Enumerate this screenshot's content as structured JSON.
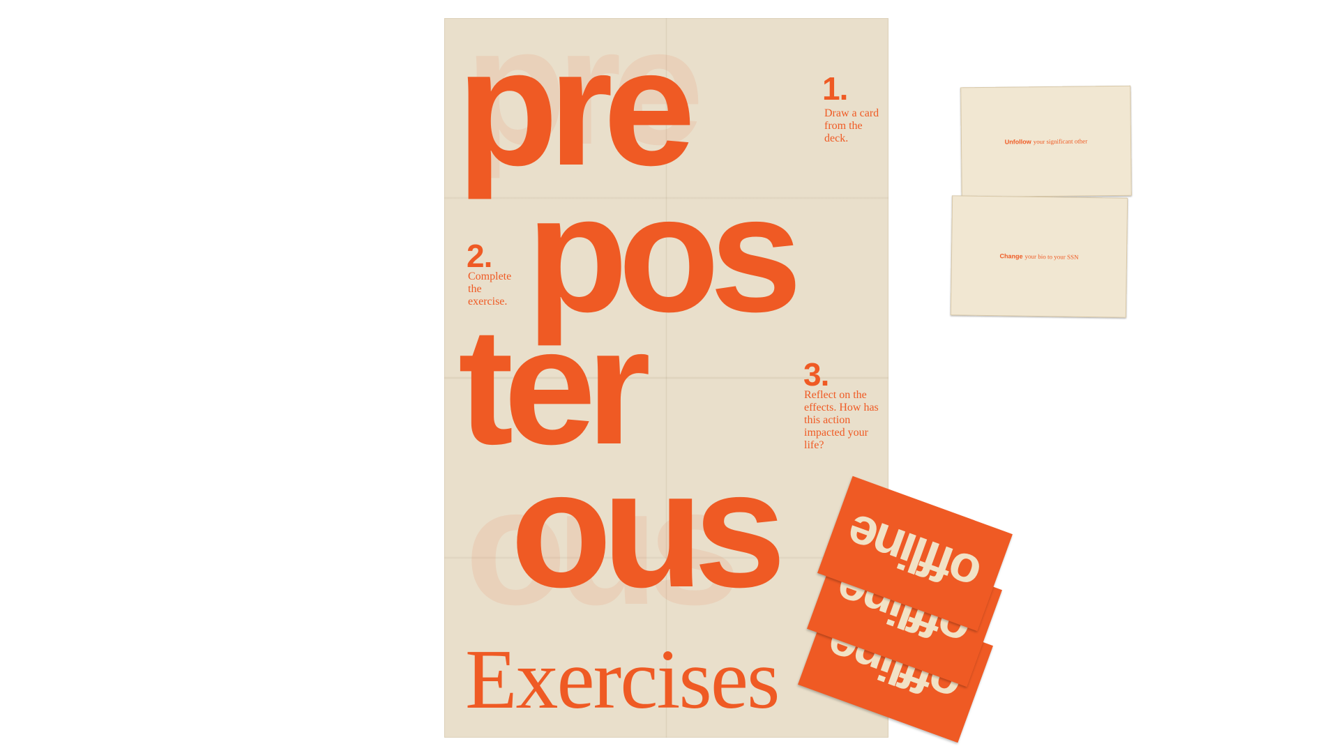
{
  "poster": {
    "lines": [
      "pre",
      "pos",
      "ter",
      "ous"
    ],
    "steps": [
      {
        "number": "1.",
        "text": "Draw a card from the deck."
      },
      {
        "number": "2.",
        "text": "Complete the exercise."
      },
      {
        "number": "3.",
        "text": "Reflect on the effects. How has this action impacted your life?"
      }
    ],
    "subtitle": "Exercises"
  },
  "cards": {
    "cream": [
      {
        "verb": "Unfollow",
        "rest": "your significant other"
      },
      {
        "verb": "Change",
        "rest": "your bio to your SSN"
      }
    ],
    "orange_word": "offline"
  },
  "colors": {
    "accent": "#ef5a24",
    "paper": "#e9dfcb",
    "card_cream": "#f1e7d2"
  }
}
